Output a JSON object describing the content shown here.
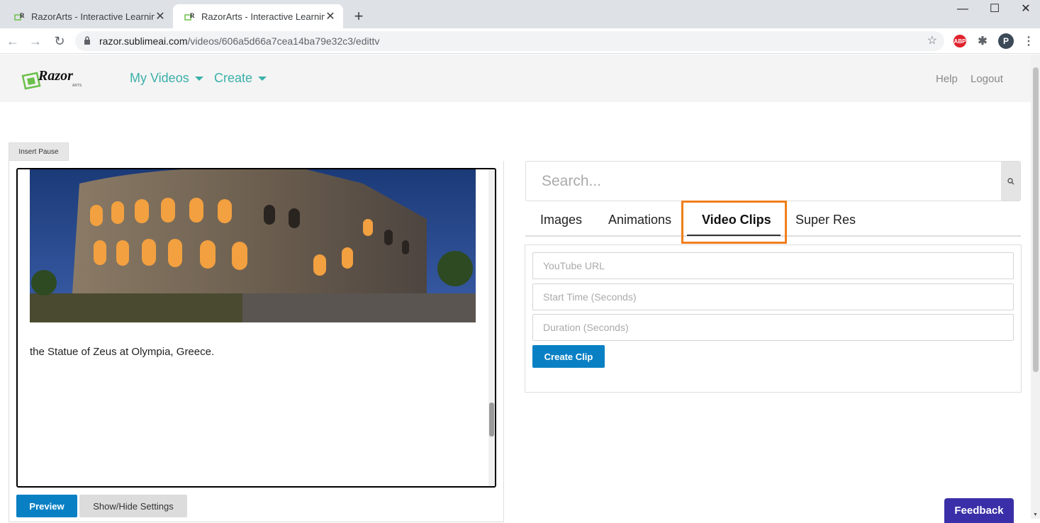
{
  "browser": {
    "tabs": [
      {
        "title": "RazorArts - Interactive Learning",
        "active": false
      },
      {
        "title": "RazorArts - Interactive Learning",
        "active": true
      }
    ],
    "new_tab_icon": "plus-icon",
    "window_controls": {
      "minimize": "—",
      "maximize": "☐",
      "close": "✕"
    },
    "url_domain": "razor.sublimeai.com",
    "url_path": "/videos/606a5d66a7cea14ba79e32c3/edittv",
    "profile_initial": "P",
    "abp_label": "ABP"
  },
  "site": {
    "logo_text": "Razor",
    "logo_subtext": "ARTS",
    "nav": {
      "my_videos": "My Videos",
      "create": "Create",
      "help": "Help",
      "logout": "Logout"
    }
  },
  "editor": {
    "insert_pause_label": "Insert Pause",
    "caption_text": "the Statue of Zeus at Olympia, Greece.",
    "preview_label": "Preview",
    "settings_label": "Show/Hide Settings"
  },
  "media": {
    "search_placeholder": "Search...",
    "tabs": [
      "Images",
      "Animations",
      "Video Clips",
      "Super Res"
    ],
    "active_tab": "Video Clips",
    "youtube_placeholder": "YouTube URL",
    "start_placeholder": "Start Time (Seconds)",
    "duration_placeholder": "Duration (Seconds)",
    "create_clip_label": "Create Clip"
  },
  "feedback_label": "Feedback",
  "colors": {
    "accent_teal": "#3bb0a9",
    "primary_blue": "#0a80c4",
    "highlight_orange": "#f07e1b",
    "feedback_purple": "#3a2fa8"
  }
}
